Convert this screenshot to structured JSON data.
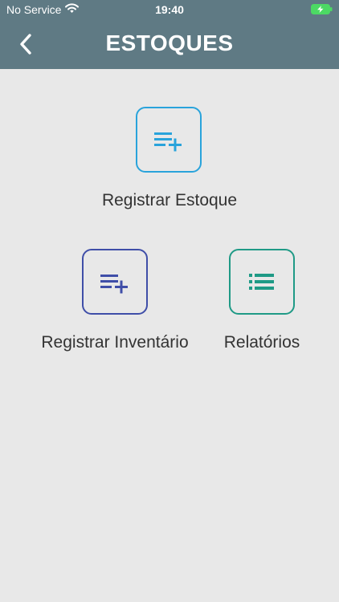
{
  "status_bar": {
    "carrier": "No Service",
    "time": "19:40",
    "battery_color": "#4cd964"
  },
  "header": {
    "title": "ESTOQUES",
    "background_color": "#5f7a84"
  },
  "menu": [
    {
      "id": "registrar-estoque",
      "label": "Registrar Estoque",
      "icon": "playlist-add-icon",
      "color": "#29a3db"
    },
    {
      "id": "registrar-inventario",
      "label": "Registrar Inventário",
      "icon": "playlist-add-icon",
      "color": "#3f4ea8"
    },
    {
      "id": "relatorios",
      "label": "Relatórios",
      "icon": "list-icon",
      "color": "#1f9a86"
    }
  ]
}
